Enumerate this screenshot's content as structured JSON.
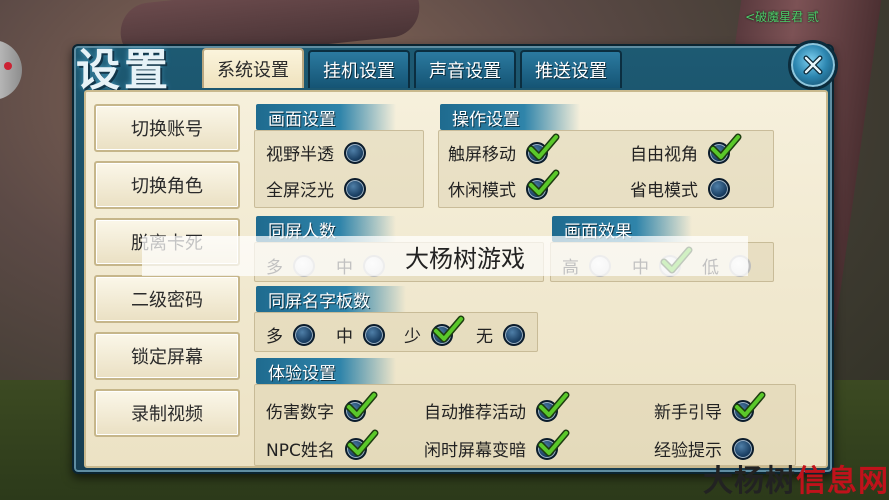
{
  "quest": {
    "line1": "<破魔星君 贰",
    "line2": ""
  },
  "title": "设置",
  "tabs": [
    {
      "label": "系统设置",
      "active": true
    },
    {
      "label": "挂机设置",
      "active": false
    },
    {
      "label": "声音设置",
      "active": false
    },
    {
      "label": "推送设置",
      "active": false
    }
  ],
  "menu": [
    "切换账号",
    "切换角色",
    "脱离卡死",
    "二级密码",
    "锁定屏幕",
    "录制视频"
  ],
  "sections": {
    "display": {
      "title": "画面设置",
      "options": [
        {
          "label": "视野半透",
          "checked": false
        },
        {
          "label": "全屏泛光",
          "checked": false
        }
      ]
    },
    "control": {
      "title": "操作设置",
      "options": [
        {
          "label": "触屏移动",
          "checked": true
        },
        {
          "label": "自由视角",
          "checked": true
        },
        {
          "label": "休闲模式",
          "checked": true
        },
        {
          "label": "省电模式",
          "checked": false
        }
      ]
    },
    "same_screen_people": {
      "title": "同屏人数",
      "options": [
        {
          "label": "多",
          "checked": false
        },
        {
          "label": "中",
          "checked": false
        }
      ]
    },
    "effects": {
      "title": "画面效果",
      "options": [
        {
          "label": "高",
          "checked": false
        },
        {
          "label": "中",
          "checked": true
        },
        {
          "label": "低",
          "checked": false
        }
      ]
    },
    "nameplates": {
      "title": "同屏名字板数",
      "options": [
        {
          "label": "多",
          "checked": false
        },
        {
          "label": "中",
          "checked": false
        },
        {
          "label": "少",
          "checked": true
        },
        {
          "label": "无",
          "checked": false
        }
      ]
    },
    "experience": {
      "title": "体验设置",
      "options": [
        {
          "label": "伤害数字",
          "checked": true
        },
        {
          "label": "自动推荐活动",
          "checked": true
        },
        {
          "label": "新手引导",
          "checked": true
        },
        {
          "label": "NPC姓名",
          "checked": true
        },
        {
          "label": "闲时屏幕变暗",
          "checked": true
        },
        {
          "label": "经验提示",
          "checked": false
        }
      ]
    }
  },
  "watermark": {
    "center": "大杨树游戏",
    "corner_black": "大杨树",
    "corner_red": "信息网"
  },
  "colors": {
    "check": "#5ac82a",
    "panel": "#1d5a73",
    "paper": "#f3ecd5"
  }
}
